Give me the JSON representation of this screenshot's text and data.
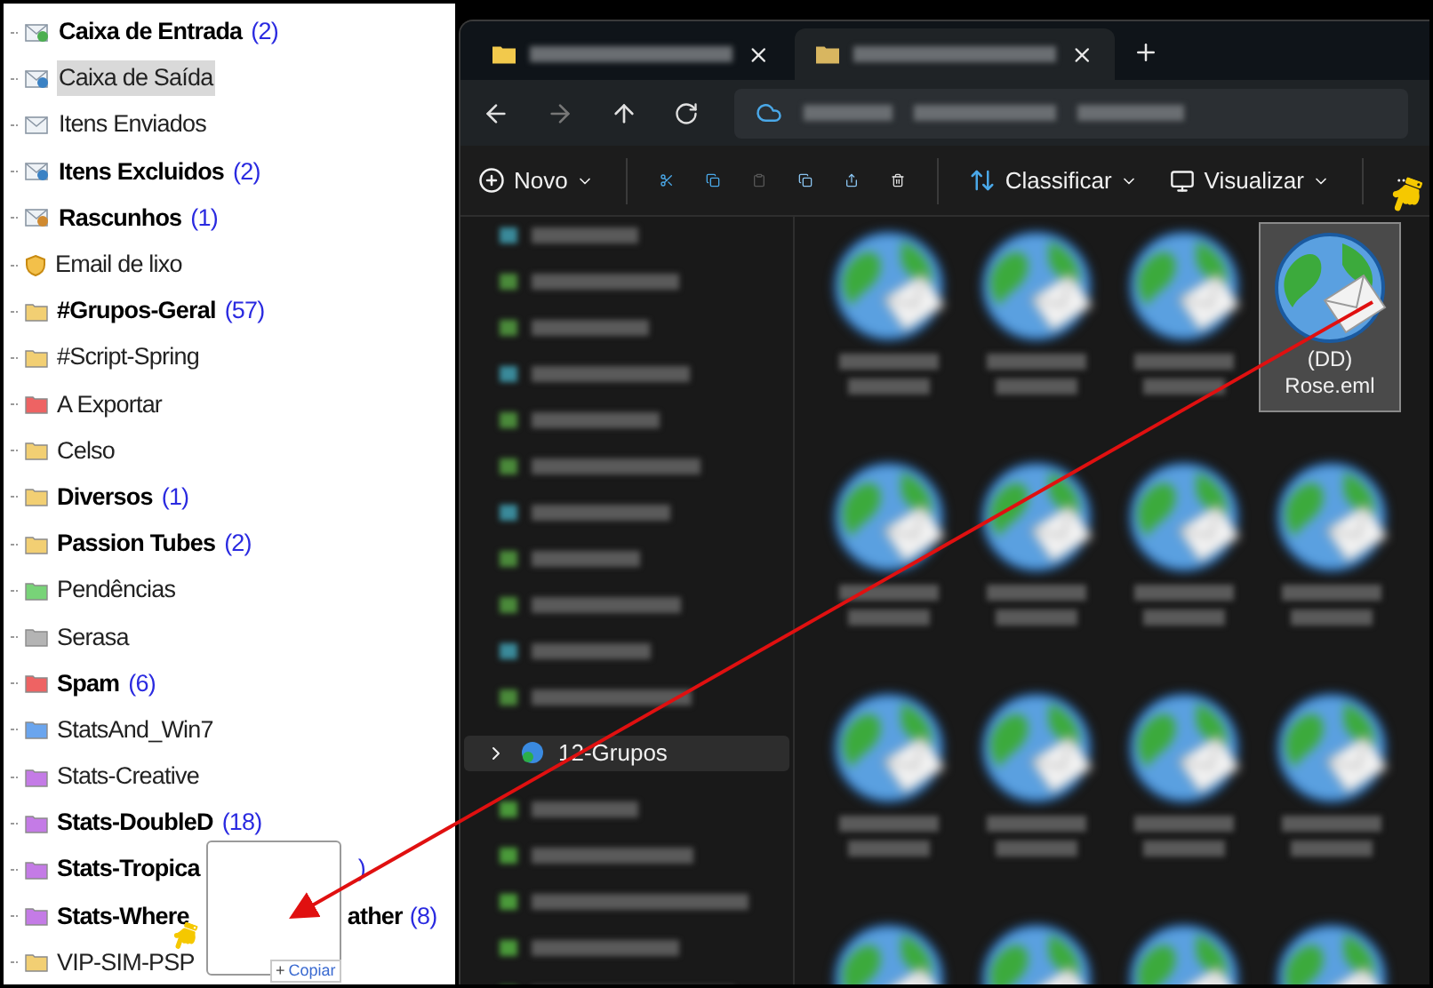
{
  "folders": [
    {
      "kind": "inbox",
      "name": "Caixa de Entrada",
      "count": "(2)",
      "bold": true,
      "selected": false
    },
    {
      "kind": "outbox",
      "name": "Caixa de Saída",
      "bold": false,
      "selected": true
    },
    {
      "kind": "sent",
      "name": "Itens Enviados",
      "bold": false,
      "selected": false
    },
    {
      "kind": "deleted",
      "name": "Itens Excluidos",
      "count": "(2)",
      "bold": true,
      "selected": false
    },
    {
      "kind": "drafts",
      "name": "Rascunhos",
      "count": "(1)",
      "bold": true,
      "selected": false
    },
    {
      "kind": "junk",
      "name": "Email de lixo",
      "bold": false,
      "selected": false
    },
    {
      "kind": "folder",
      "color": "#f2cf73",
      "name": "#Grupos-Geral",
      "count": "(57)",
      "bold": true,
      "selected": false
    },
    {
      "kind": "folder",
      "color": "#f2cf73",
      "name": "#Script-Spring",
      "bold": false,
      "selected": false
    },
    {
      "kind": "folder",
      "color": "#ee6363",
      "name": "A Exportar",
      "bold": false,
      "selected": false
    },
    {
      "kind": "folder",
      "color": "#f2cf73",
      "name": "Celso",
      "bold": false,
      "selected": false
    },
    {
      "kind": "folder",
      "color": "#f2cf73",
      "name": "Diversos",
      "count": "(1)",
      "bold": true,
      "selected": false
    },
    {
      "kind": "folder",
      "color": "#f2cf73",
      "name": "Passion Tubes",
      "count": "(2)",
      "bold": true,
      "selected": false
    },
    {
      "kind": "folder",
      "color": "#78d378",
      "name": "Pendências",
      "bold": false,
      "selected": false
    },
    {
      "kind": "folder",
      "color": "#b4b4b4",
      "name": "Serasa",
      "bold": false,
      "selected": false
    },
    {
      "kind": "folder",
      "color": "#ee6363",
      "name": "Spam",
      "count": "(6)",
      "bold": true,
      "selected": false
    },
    {
      "kind": "folder",
      "color": "#6aa5ee",
      "name": "StatsAnd_Win7",
      "bold": false,
      "selected": false
    },
    {
      "kind": "folder",
      "color": "#c47be6",
      "name": "Stats-Creative",
      "bold": false,
      "selected": false
    },
    {
      "kind": "folder",
      "color": "#c47be6",
      "name": "Stats-DoubleD",
      "count": "(18)",
      "bold": true,
      "selected": false
    },
    {
      "kind": "folder",
      "color": "#c47be6",
      "name": "Stats-Tropica",
      "covered": true,
      "count": ")",
      "bold": true,
      "selected": false
    },
    {
      "kind": "folder",
      "color": "#c47be6",
      "name": "Stats-Where",
      "covered": true,
      "name_end": "ather",
      "count": "(8)",
      "bold": true,
      "selected": false
    },
    {
      "kind": "folder",
      "color": "#f2cf73",
      "name": "VIP-SIM-PSP",
      "bold": false,
      "selected": false
    }
  ],
  "explorer": {
    "tabs": [
      {
        "selected": false
      },
      {
        "selected": true
      }
    ],
    "toolbar": {
      "new": "Novo",
      "sort": "Classificar",
      "view": "Visualizar"
    },
    "tree": [
      {
        "label": "12-Grupos",
        "expanded": false,
        "selected": true
      }
    ],
    "file": {
      "line1": "(DD)",
      "line2": "Rose.eml",
      "selected": true
    }
  },
  "drag": {
    "badge_symbol": "+",
    "badge": "Copiar"
  }
}
